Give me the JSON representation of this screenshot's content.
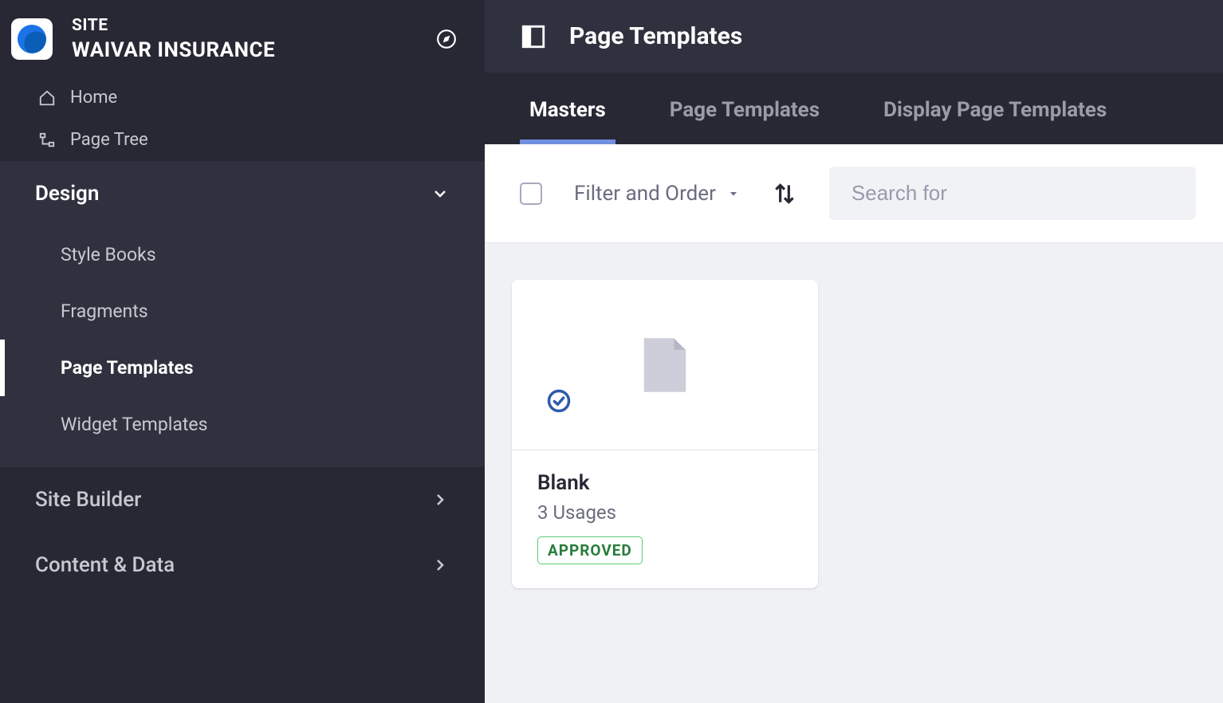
{
  "sidebar": {
    "site_label": "SITE",
    "site_name": "WAIVAR INSURANCE",
    "home_label": "Home",
    "page_tree_label": "Page Tree",
    "groups": {
      "design": {
        "label": "Design",
        "items": [
          "Style Books",
          "Fragments",
          "Page Templates",
          "Widget Templates"
        ]
      },
      "site_builder": {
        "label": "Site Builder"
      },
      "content_data": {
        "label": "Content & Data"
      }
    }
  },
  "header": {
    "title": "Page Templates"
  },
  "tabs": [
    "Masters",
    "Page Templates",
    "Display Page Templates"
  ],
  "toolbar": {
    "filter_label": "Filter and Order",
    "search_placeholder": "Search for"
  },
  "templates": [
    {
      "name": "Blank",
      "usages": "3 Usages",
      "status": "APPROVED"
    }
  ]
}
